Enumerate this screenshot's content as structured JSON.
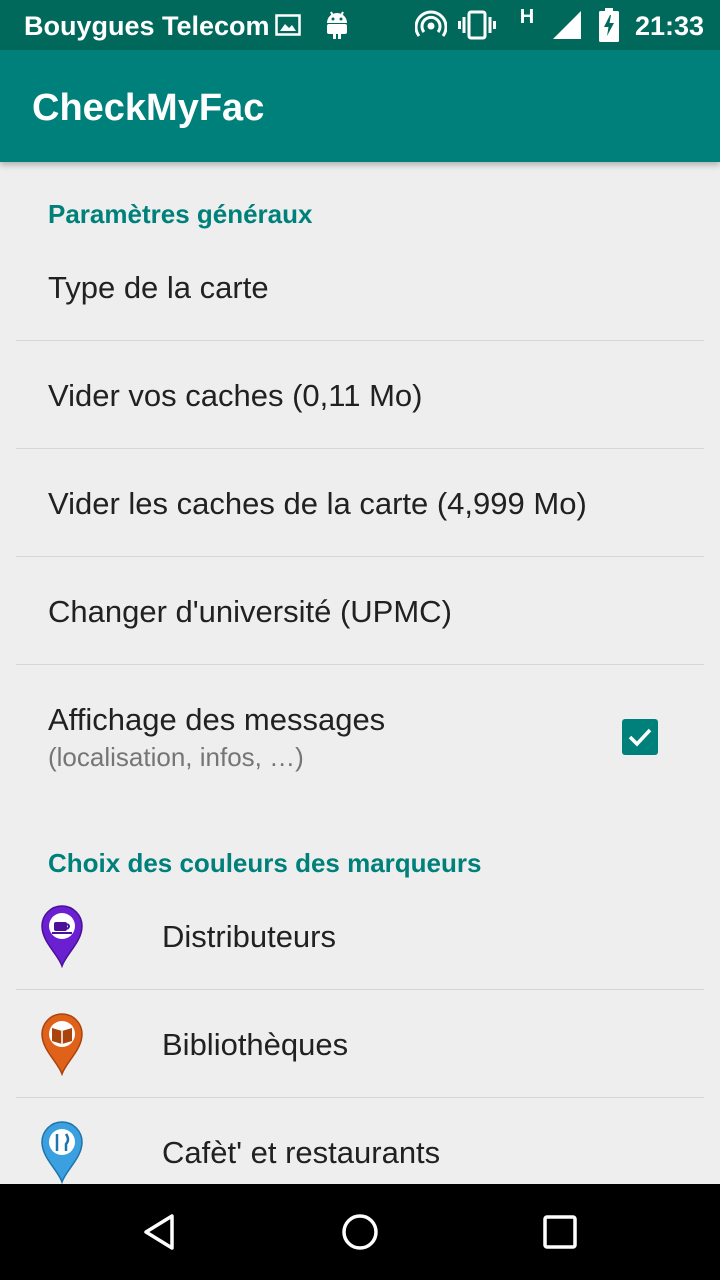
{
  "status_bar": {
    "carrier": "Bouygues Telecom",
    "network_type": "H",
    "time": "21:33",
    "icons": [
      "image-icon",
      "android-icon",
      "hotspot-icon",
      "vibrate-icon",
      "signal-icon",
      "battery-charging-icon"
    ]
  },
  "app_bar": {
    "title": "CheckMyFac"
  },
  "general": {
    "header": "Paramètres généraux",
    "items": [
      {
        "title": "Type de la carte"
      },
      {
        "title": "Vider vos caches (0,11 Mo)"
      },
      {
        "title": "Vider les caches de la carte (4,999 Mo)"
      },
      {
        "title": "Changer d'université (UPMC)"
      }
    ],
    "messages": {
      "title": "Affichage des messages",
      "summary": "(localisation, infos, …)",
      "checked": true
    }
  },
  "markers": {
    "header": "Choix des couleurs des marqueurs",
    "items": [
      {
        "title": "Distributeurs",
        "icon": "coffee-marker-icon",
        "color": "#6a1fd0"
      },
      {
        "title": "Bibliothèques",
        "icon": "book-marker-icon",
        "color": "#e0621a"
      },
      {
        "title": "Cafèt' et restaurants",
        "icon": "restaurant-marker-icon",
        "color": "#3aa0e0"
      }
    ]
  },
  "colors": {
    "status_bar": "#00695c",
    "app_bar": "#00807a",
    "accent": "#00807a",
    "background": "#eeeeee"
  },
  "nav_bar": {
    "buttons": [
      "back-icon",
      "home-icon",
      "recents-icon"
    ]
  }
}
